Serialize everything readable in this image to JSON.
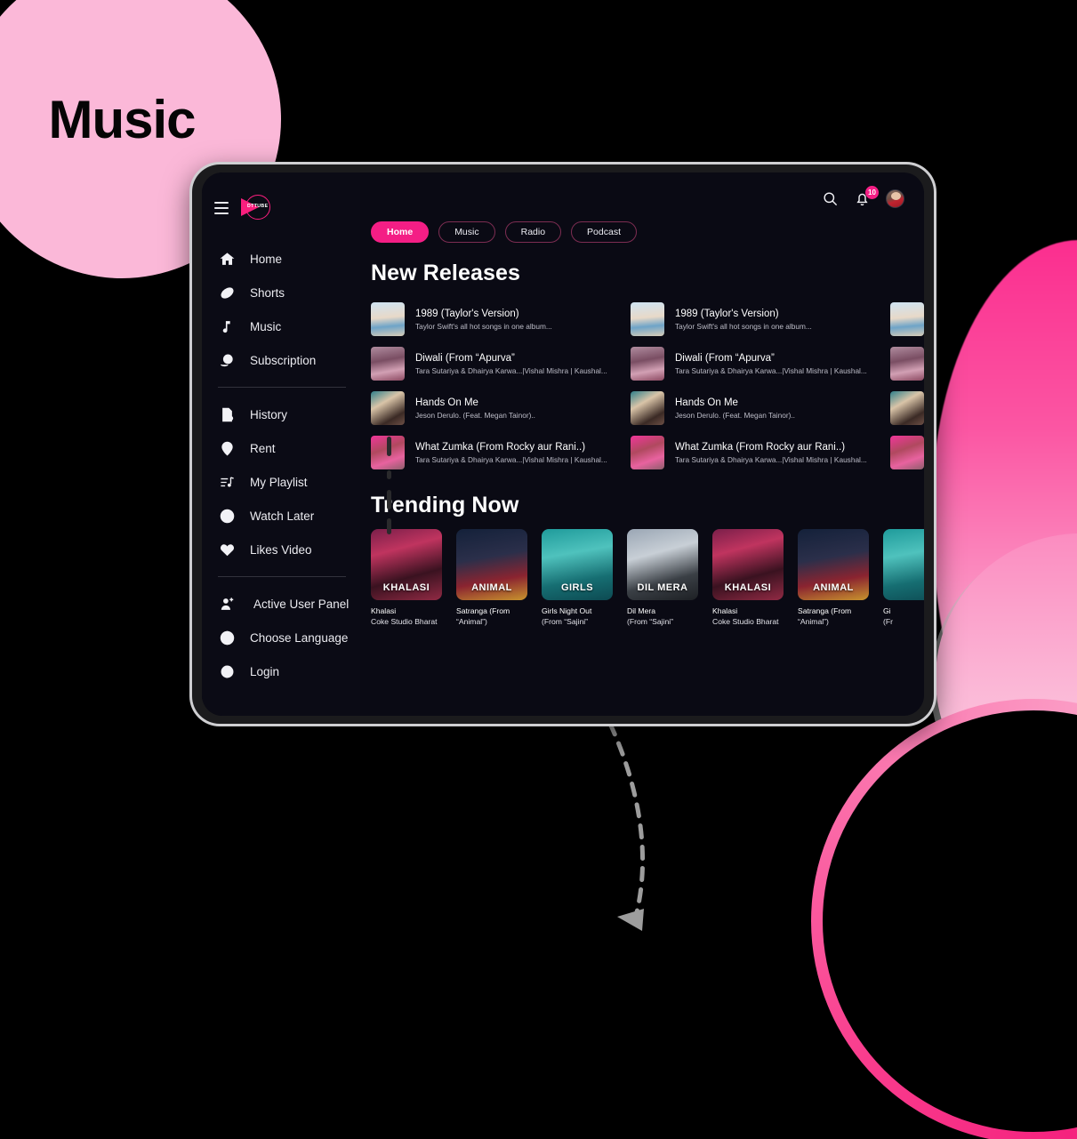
{
  "decor": {
    "bubble_label": "Music",
    "bubble_color": "#FBB8D8",
    "blob_color_top": "#FB2E8F",
    "blob_color_bottom": "#FBC3DC",
    "ring_color": "#F5227E",
    "arrow_color": "#9d9d9d"
  },
  "app": {
    "accent": "#F41E85",
    "background": "#0a0a14",
    "brand": {
      "name": "DTTUBE",
      "menu_icon": "hamburger-icon"
    }
  },
  "sidebar": {
    "primary": [
      {
        "label": "Home",
        "icon": "home-icon"
      },
      {
        "label": "Shorts",
        "icon": "shorts-icon"
      },
      {
        "label": "Music",
        "icon": "music-note-icon"
      },
      {
        "label": "Subscription",
        "icon": "subscription-dollar-icon"
      }
    ],
    "secondary": [
      {
        "label": "Watch Later",
        "icon": "clock-icon"
      },
      {
        "label": "History",
        "icon": "history-doc-icon"
      },
      {
        "label": "Rent",
        "icon": "rent-pin-icon"
      },
      {
        "label": "My Playlist",
        "icon": "playlist-icon"
      },
      {
        "label": "Likes Video",
        "icon": "heart-icon"
      }
    ],
    "tertiary": [
      {
        "label": "Active User Panel",
        "icon": "user-add-icon"
      },
      {
        "label": "Choose Language",
        "icon": "globe-icon"
      },
      {
        "label": "Login",
        "icon": "circle-icon"
      }
    ]
  },
  "header": {
    "search_icon": "search-icon",
    "notification_icon": "bell-icon",
    "notification_count": "10",
    "avatar": "user-avatar"
  },
  "tabs": [
    {
      "label": "Home",
      "active": true
    },
    {
      "label": "Music",
      "active": false
    },
    {
      "label": "Radio",
      "active": false
    },
    {
      "label": "Podcast",
      "active": false
    }
  ],
  "new_releases": {
    "title": "New Releases",
    "items": [
      {
        "title": "1989 (Taylor's Version)",
        "subtitle": "Taylor Swift's all hot songs in one album...",
        "art": "taylor"
      },
      {
        "title": "Diwali (From “Apurva”",
        "subtitle": "Tara Sutariya & Dhairya Karwa...|Vishal Mishra | Kaushal...",
        "art": "diwali"
      },
      {
        "title": "Hands On Me",
        "subtitle": "Jeson Derulo. (Feat. Megan Tainor)..",
        "art": "hands"
      },
      {
        "title": "What Zumka (From Rocky aur Rani..)",
        "subtitle": "Tara Sutariya & Dhairya Karwa...|Vishal Mishra | Kaushal...",
        "art": "zumka"
      }
    ]
  },
  "trending": {
    "title": "Trending Now",
    "items": [
      {
        "name": "Khalasi",
        "sub": "Coke Studio Bharat",
        "art": "khalasi",
        "label": "KHALASI"
      },
      {
        "name": "Satranga (From",
        "sub": "“Animal”)",
        "art": "satranga",
        "label": "ANIMAL"
      },
      {
        "name": "Girls Night Out",
        "sub": "(From “Sajini”",
        "art": "girls",
        "label": "GIRLS"
      },
      {
        "name": "Dil Mera",
        "sub": "(From “Sajini”",
        "art": "dilmera",
        "label": "DIL MERA"
      },
      {
        "name": "Khalasi",
        "sub": "Coke Studio Bharat",
        "art": "khalasi",
        "label": "KHALASI"
      },
      {
        "name": "Satranga (From",
        "sub": "“Animal”)",
        "art": "satranga",
        "label": "ANIMAL"
      },
      {
        "name": "Gi",
        "sub": "(Fr",
        "art": "girls",
        "label": ""
      }
    ]
  }
}
